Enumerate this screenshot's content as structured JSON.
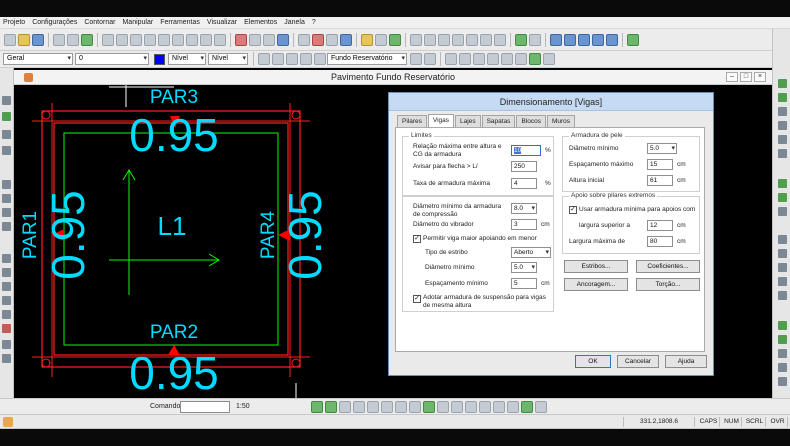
{
  "menu": [
    "Projeto",
    "Configurações",
    "Contornar",
    "Manipular",
    "Ferramentas",
    "Visualizar",
    "Elementos",
    "Janela",
    "?"
  ],
  "toolbar2": {
    "layer_group": "Geral",
    "layer_value": "0",
    "color": "#0000ff",
    "nivel1": "Nível",
    "nivel2": "Nível",
    "pavement": "Fundo Reservatório"
  },
  "document": {
    "title": "Pavimento Fundo Reservatório"
  },
  "drawing": {
    "label_top": "PAR3",
    "value_top": "0.95",
    "label_left": "PAR1",
    "value_left": "0.95",
    "label_center": "L1",
    "label_right": "PAR4",
    "value_right": "0.95",
    "label_bottom": "PAR2",
    "value_bottom": "0.95",
    "colors": {
      "wall": "#ff2020",
      "slab": "#00ff00",
      "text": "#00dcff",
      "marker": "#ff0000"
    }
  },
  "dialog": {
    "title": "Dimensionamento [Vigas]",
    "tabs": [
      "Pilares",
      "Vigas",
      "Lajes",
      "Sapatas",
      "Blocos",
      "Muros"
    ],
    "active_tab": "Vigas",
    "limites": {
      "title": "Limites",
      "rel_label": "Relação máxima entre altura e CG da armadura",
      "rel_value": "10",
      "rel_unit": "%",
      "flecha_label": "Avisar para flecha > L/",
      "flecha_value": "250",
      "taxa_label": "Taxa de armadura máxima",
      "taxa_value": "4",
      "taxa_unit": "%"
    },
    "compressao": {
      "diam_label": "Diâmetro mínimo da armadura de compressão",
      "diam_value": "8.0",
      "vibrador_label": "Diâmetro do vibrador",
      "vibrador_value": "3",
      "vibrador_unit": "cm",
      "permitir_label": "Permitir viga maior apoiando em menor",
      "estribo_label": "Tipo de estribo",
      "estribo_value": "Aberto",
      "diam_min_label": "Diâmetro mínimo",
      "diam_min_value": "5.0",
      "esp_min_label": "Espaçamento mínimo",
      "esp_min_value": "5",
      "esp_min_unit": "cm",
      "adotar_label": "Adotar armadura de suspensão para vigas de mesma altura"
    },
    "pele": {
      "title": "Armadura de pele",
      "diam_label": "Diâmetro mínimo",
      "diam_value": "5.0",
      "esp_label": "Espaçamento máximo",
      "esp_value": "15",
      "esp_unit": "cm",
      "altura_label": "Altura inicial",
      "altura_value": "61",
      "altura_unit": "cm"
    },
    "apoio": {
      "title": "Apoio sobre pilares extremos",
      "usar_label": "Usar armadura mínima para apoios com",
      "largura_sup_label": "largura superior a",
      "largura_sup_value": "12",
      "largura_sup_unit": "cm",
      "largura_max_label": "Largura máxima de",
      "largura_max_value": "80",
      "largura_max_unit": "cm"
    },
    "buttons": {
      "estribos": "Estribos...",
      "coeficientes": "Coeficientes...",
      "ancoragem": "Ancoragem...",
      "torcao": "Torção...",
      "ok": "OK",
      "cancelar": "Cancelar",
      "ajuda": "Ajuda"
    }
  },
  "cmdbar": {
    "label": "Comando",
    "scale": "1:50"
  },
  "status": {
    "coords": "331.2,1808.6",
    "keys": [
      "CAPS",
      "NUM",
      "SCRL",
      "OVR"
    ]
  }
}
